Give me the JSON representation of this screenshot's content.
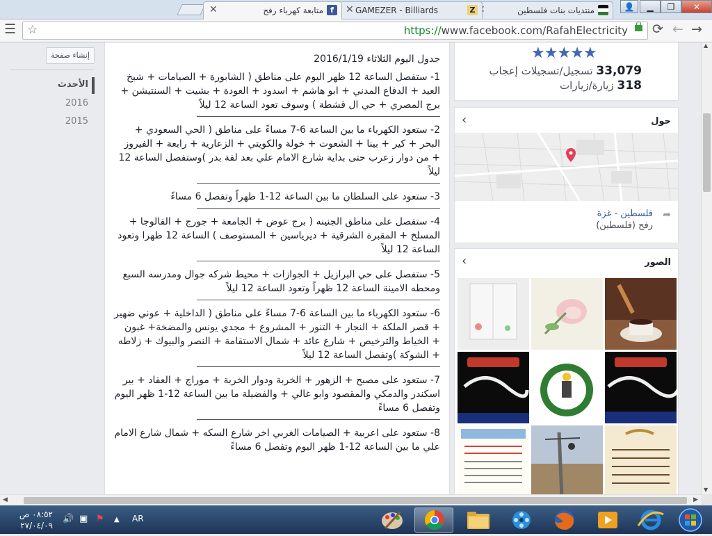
{
  "browser": {
    "tabs": [
      {
        "title": "متابعة كهرباء رفح",
        "favicon": "f",
        "favicon_color": "#3b5998",
        "active": true
      },
      {
        "title": "GAMEZER - Billiards",
        "favicon": "Z",
        "favicon_color": "#222222",
        "active": false
      },
      {
        "title": "منتديات بنات فلسطين",
        "favicon": "",
        "favicon_color": "#2e7d32",
        "active": false
      }
    ],
    "url_secure": "https://",
    "url_rest": "www.facebook.com/RafahElectricity"
  },
  "left_nav": {
    "create_page": "إنشاء صفحة",
    "items": [
      {
        "label": "الأحدث"
      },
      {
        "label": "2016"
      },
      {
        "label": "2015"
      }
    ]
  },
  "post": {
    "header": "جدول اليوم الثلاثاء 2016/1/19",
    "paragraphs": [
      "1- ستفصل الساعة 12 ظهر اليوم على مناطق ( الشابورة + الصيامات + شيخ العيد + الدفاع المدني + ابو هاشم + اسدود + العودة + بشيت + السنتيشن + برج المصري + حي ال قشطة ) وسوف تعود الساعة 12 ليلاً",
      "2- ستعود الكهرباء ما بين الساعة 6-7 مساءً على مناطق ( الحي السعودي + البحر + كير + بينا + الشعوت + خولة والكويتي + الزعارية + رابعة + الفيروز + من دوار زعرب حتى بداية شارع الامام علي بعد لفة بدر )وستفصل الساعة 12 ليلاً",
      "3- ستعود على السلطان ما بين الساعة 12-1 ظهراً وتفصل 6 مساءً",
      "4- ستفصل على مناطق الجنينه ( برج عوض + الجامعة + جورج + الفالوجا + المسلخ + المقبرة الشرقية + ديرياسين + المستوصف ) الساعة 12 ظهرا وتعود الساعة 12 ليلاً",
      "5- ستفصل على حي البرازيل + الجوازات + محيط شركه جوال ومدرسه السبع ومحطه الامينة الساعة 12 ظهراً وتعود الساعة 12 ليلاً",
      "6- ستعود الكهرباء ما بين الساعة 6-7 مساءً على مناطق ( الداخلية + عوني ضهير + قصر الملكة + النجار + التنور + المشروع + مجدي يونس والمضخة+ غبون + الخياط والترخيص + شارع عائد + شمال الاستقامة + النصر والبيوك + زلاطه + الشوكة )وتفصل الساعة 12 ليلاً",
      "7- ستعود على مصبح + الزهور + الخربة ودوار الخربة + موراج + العقاد + بير اسكندر والدمكي والمقصود وابو غالي + والفضيلة ما بين الساعة 12-1 ظهر اليوم وتفصل 6 مساءً",
      "8- ستعود على اعربية + الصيامات الغربي اخر شارع السكه + شمال شارع الامام علي ما بين الساعة 12-1 ظهر اليوم وتفصل 6 مساءً"
    ]
  },
  "sidebar": {
    "rating": {
      "stars": 5,
      "icon": "star-icon"
    },
    "likes_count": "33,079",
    "likes_label": "تسجيل/تسجيلات إعجاب",
    "visits_count": "318",
    "visits_label": "زيارة/زيارات",
    "about_title": "حول",
    "address_line1": "فلسطين - غزة",
    "address_line2": "رفح (فلسطين)",
    "photos_title": "الصور"
  },
  "taskbar": {
    "time": "٠٨:٥٢ ص",
    "date": "٢٧/٠٤/٠٩",
    "language": "AR"
  },
  "colors": {
    "facebook_blue": "#3b5998",
    "link_blue": "#365899",
    "secure_green": "#0b8a26",
    "taskbar": "#1d3556"
  }
}
